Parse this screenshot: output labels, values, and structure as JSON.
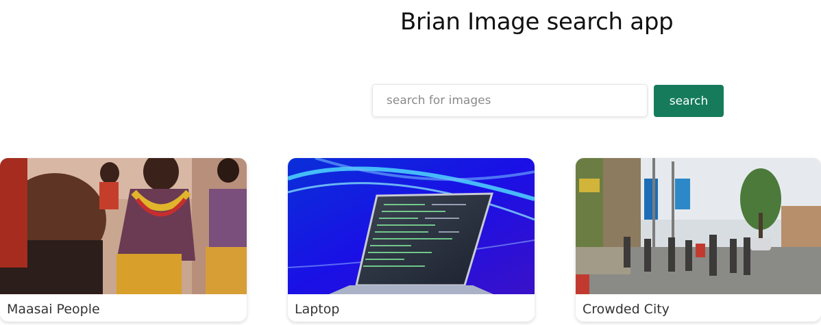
{
  "app": {
    "title": "Brian Image search app"
  },
  "search": {
    "placeholder": "search for images",
    "value": "",
    "button_label": "search"
  },
  "results": [
    {
      "caption": "Maasai People",
      "image_icon": "photo-maasai-people"
    },
    {
      "caption": "Laptop",
      "image_icon": "photo-laptop"
    },
    {
      "caption": "Crowded City",
      "image_icon": "photo-crowded-city"
    }
  ],
  "colors": {
    "accent": "#157b5b",
    "background": "#ffffff"
  }
}
